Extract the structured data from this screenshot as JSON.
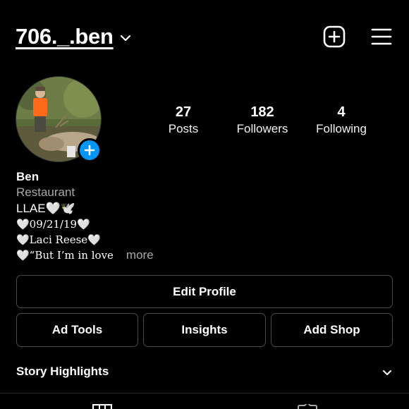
{
  "header": {
    "username": "706._.ben",
    "icons": {
      "dropdown": "chevron-down-icon",
      "new_post": "plus-square-icon",
      "menu": "hamburger-menu-icon"
    }
  },
  "profile": {
    "avatar": "profile-photo",
    "stats": [
      {
        "value": "27",
        "label": "Posts"
      },
      {
        "value": "182",
        "label": "Followers"
      },
      {
        "value": "4",
        "label": "Following"
      }
    ]
  },
  "bio": {
    "name": "Ben",
    "category": "Restaurant",
    "line1": "LLAE🤍🕊️",
    "line2": "🤍09/21/19🤍",
    "line3": "🤍Laci Reese🤍",
    "line4": "🤍“But I’m in love",
    "more": "more"
  },
  "buttons": {
    "edit_profile": "Edit Profile",
    "ad_tools": "Ad Tools",
    "insights": "Insights",
    "add_shop": "Add Shop"
  },
  "highlights": {
    "label": "Story Highlights"
  },
  "tabs": {
    "grid": "grid-icon",
    "tagged": "tagged-icon"
  },
  "colors": {
    "accent": "#0095f6",
    "background": "#000000",
    "border": "#4a4a4a",
    "muted": "#a8a8a8"
  }
}
